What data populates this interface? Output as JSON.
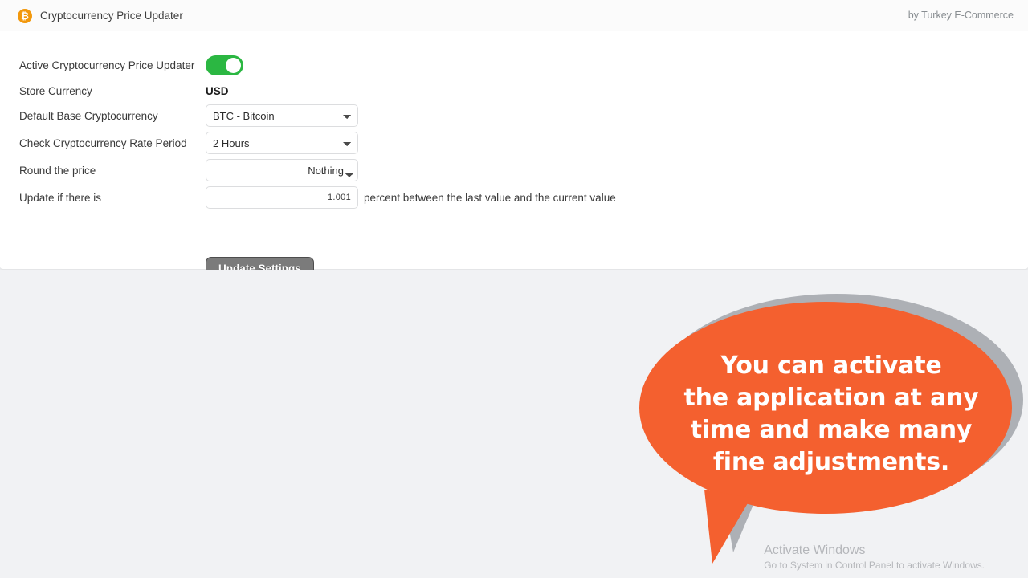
{
  "header": {
    "icon": "bitcoin-icon",
    "icon_glyph": "₿",
    "title": "Cryptocurrency Price Updater",
    "credit": "by Turkey E-Commerce",
    "icon_color": "#f2980c"
  },
  "form": {
    "rows": [
      {
        "label": "Active Cryptocurrency Price Updater",
        "type": "toggle",
        "value": "on"
      },
      {
        "label": "Store Currency",
        "type": "static",
        "value": "USD"
      },
      {
        "label": "Default Base Cryptocurrency",
        "type": "select",
        "value": "BTC - Bitcoin"
      },
      {
        "label": "Check Cryptocurrency Rate Period",
        "type": "select",
        "value": "2 Hours"
      },
      {
        "label": "Round the price",
        "type": "select-right",
        "value": "Nothing"
      },
      {
        "label": "Update if there is",
        "type": "number",
        "value": "1.001",
        "suffix": "percent between the last value and the current value"
      }
    ],
    "submit_label": "Update Settings"
  },
  "bubble": {
    "text": "You can activate the application at any time and make many fine adjustments.",
    "line1": "You can activate",
    "line2": "the application at any",
    "line3": "time and make many",
    "line4": "fine adjustments.",
    "fill_color": "#f4602f",
    "shadow_color": "#adb0b5"
  },
  "watermark": {
    "title": "Activate Windows",
    "subtitle": "Go to System in Control Panel to activate Windows."
  }
}
